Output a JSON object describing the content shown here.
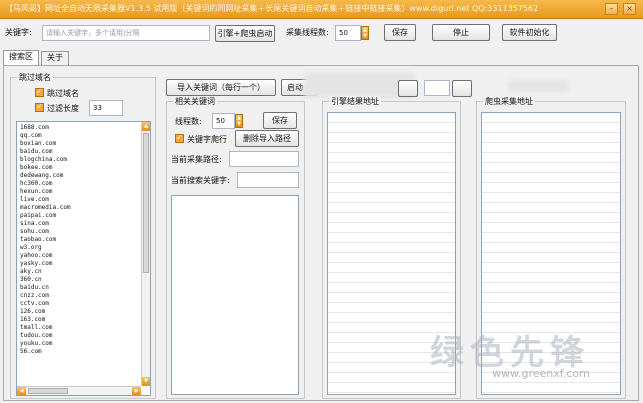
{
  "window": {
    "title": "【马风哥】网址全自动无限采集器V1.3.5 试用版（关键词的同网址采集＋长尾关键词自动采集＋链接中链接采集）www.digurl.net QQ:3311357562",
    "minimize_icon": "minimize-icon",
    "close_icon": "close-icon"
  },
  "toolbar": {
    "keyword_label": "关键字:",
    "keyword_placeholder": "请输入关键字，多个请用|分隔",
    "engine_start_button": "引擎+爬虫启动",
    "collect_threads_label": "采集线程数:",
    "collect_threads_value": "50",
    "save_button": "保存",
    "stop_button": "停止",
    "init_button": "软件初始化"
  },
  "tabs": [
    {
      "label": "搜索区",
      "active": true
    },
    {
      "label": "关于",
      "active": false
    }
  ],
  "skip_domain": {
    "group_title": "跳过域名",
    "skip_checkbox_label": "跳过域名",
    "filter_length_label": "过滤长度",
    "filter_length_value": "33",
    "domains": [
      "1688.com",
      "qq.com",
      "boxian.com",
      "baidu.com",
      "blogchina.com",
      "bokee.com",
      "dedewang.com",
      "hc360.com",
      "hexun.com",
      "live.com",
      "macromedia.com",
      "paipai.com",
      "sina.com",
      "sohu.com",
      "taobao.com",
      "w3.org",
      "yahoo.com",
      "yasky.com",
      "aky.cn",
      "360.cn",
      "baidu.cn",
      "cnzz.com",
      "cctv.com",
      "126.com",
      "163.com",
      "tmall.com",
      "tudou.com",
      "youku.com",
      "56.com"
    ]
  },
  "related_keywords": {
    "import_button": "导入关键词（每行一个）",
    "start_button_partial": "启动",
    "group_title": "相关关键词",
    "threads_label": "线程数:",
    "threads_value": "50",
    "save_button": "保存",
    "follow_checkbox_label": "关键字爬行",
    "delete_import_button": "删除导入路径",
    "current_path_label": "当前采集路径:",
    "current_keyword_label": "当前搜索关键字:"
  },
  "engine_results": {
    "title": "引擎结果地址"
  },
  "crawler_results": {
    "title": "爬虫采集地址"
  },
  "watermark": {
    "main": "绿色先锋",
    "url": "www.greenxf.com"
  }
}
